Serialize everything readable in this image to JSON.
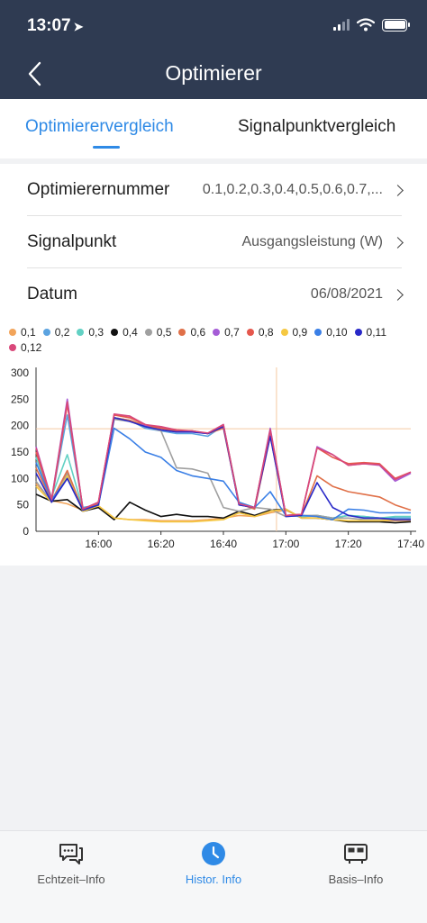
{
  "status_bar": {
    "time": "13:07"
  },
  "header": {
    "title": "Optimierer"
  },
  "tabs": [
    {
      "label": "Optimierervergleich",
      "active": true
    },
    {
      "label": "Signalpunktvergleich",
      "active": false
    }
  ],
  "settings": {
    "rows": [
      {
        "label": "Optimierernummer",
        "value": "0.1,0.2,0.3,0.4,0.5,0.6,0.7,..."
      },
      {
        "label": "Signalpunkt",
        "value": "Ausgangsleistung (W)"
      },
      {
        "label": "Datum",
        "value": "06/08/2021"
      }
    ]
  },
  "colors": {
    "accent": "#2f8ae6",
    "header_bg": "#2f3b52"
  },
  "chart_data": {
    "type": "line",
    "title": "",
    "xlabel": "",
    "ylabel": "",
    "x": [
      "15:40",
      "15:45",
      "15:50",
      "15:55",
      "16:00",
      "16:05",
      "16:10",
      "16:15",
      "16:20",
      "16:25",
      "16:30",
      "16:35",
      "16:40",
      "16:45",
      "16:50",
      "16:55",
      "17:00",
      "17:05",
      "17:10",
      "17:15",
      "17:20",
      "17:25",
      "17:30",
      "17:35",
      "17:40"
    ],
    "x_ticks": [
      "16:00",
      "16:20",
      "16:40",
      "17:00",
      "17:20",
      "17:40"
    ],
    "y_ticks": [
      0,
      50,
      100,
      150,
      200,
      250,
      300
    ],
    "ylim": [
      0,
      300
    ],
    "crosshair": {
      "x": "16:57",
      "y": 194
    },
    "grid": false,
    "legend_position": "top",
    "series": [
      {
        "name": "0,1",
        "color": "#f2a45a",
        "values": [
          90,
          58,
          52,
          40,
          48,
          25,
          22,
          22,
          20,
          20,
          20,
          22,
          25,
          30,
          28,
          35,
          40,
          26,
          25,
          22,
          20,
          20,
          20,
          20,
          20
        ]
      },
      {
        "name": "0,2",
        "color": "#5ba3e0",
        "values": [
          140,
          60,
          220,
          45,
          50,
          215,
          210,
          195,
          190,
          185,
          185,
          180,
          200,
          50,
          45,
          185,
          30,
          28,
          30,
          25,
          30,
          28,
          25,
          25,
          25
        ]
      },
      {
        "name": "0,3",
        "color": "#62d1c4",
        "values": [
          140,
          65,
          145,
          42,
          50,
          215,
          210,
          200,
          195,
          190,
          190,
          185,
          200,
          55,
          45,
          185,
          30,
          28,
          30,
          25,
          30,
          28,
          25,
          28,
          28
        ]
      },
      {
        "name": "0,4",
        "color": "#111111",
        "values": [
          70,
          57,
          60,
          38,
          45,
          22,
          55,
          40,
          28,
          32,
          28,
          28,
          25,
          38,
          30,
          40,
          42,
          25,
          25,
          22,
          18,
          18,
          18,
          16,
          18
        ]
      },
      {
        "name": "0,5",
        "color": "#a0a0a0",
        "values": [
          95,
          55,
          110,
          40,
          50,
          212,
          208,
          198,
          190,
          120,
          118,
          110,
          45,
          38,
          45,
          42,
          28,
          30,
          30,
          25,
          25,
          22,
          22,
          22,
          22
        ]
      },
      {
        "name": "0,6",
        "color": "#e07048",
        "values": [
          120,
          58,
          115,
          40,
          52,
          215,
          210,
          200,
          195,
          190,
          190,
          185,
          195,
          52,
          42,
          180,
          30,
          30,
          105,
          85,
          75,
          70,
          65,
          50,
          40
        ]
      },
      {
        "name": "0,7",
        "color": "#a55cd6",
        "values": [
          160,
          60,
          250,
          42,
          55,
          220,
          218,
          200,
          198,
          190,
          188,
          185,
          202,
          50,
          45,
          195,
          30,
          32,
          160,
          145,
          125,
          128,
          125,
          95,
          110
        ]
      },
      {
        "name": "0,8",
        "color": "#e5574d",
        "values": [
          150,
          58,
          240,
          42,
          55,
          220,
          215,
          202,
          195,
          190,
          190,
          185,
          200,
          52,
          45,
          192,
          30,
          32,
          158,
          140,
          128,
          130,
          128,
          100,
          112
        ]
      },
      {
        "name": "0,9",
        "color": "#f5c842",
        "values": [
          85,
          55,
          105,
          38,
          48,
          25,
          22,
          20,
          18,
          18,
          18,
          20,
          22,
          35,
          28,
          38,
          42,
          25,
          25,
          22,
          20,
          20,
          20,
          22,
          22
        ]
      },
      {
        "name": "0,10",
        "color": "#3a7fe6",
        "values": [
          130,
          60,
          100,
          40,
          50,
          195,
          175,
          150,
          140,
          115,
          105,
          100,
          95,
          55,
          45,
          75,
          30,
          30,
          28,
          22,
          42,
          40,
          35,
          35,
          35
        ]
      },
      {
        "name": "0,11",
        "color": "#2828c8",
        "values": [
          110,
          55,
          100,
          40,
          50,
          215,
          208,
          198,
          192,
          188,
          188,
          185,
          198,
          50,
          45,
          180,
          28,
          30,
          92,
          45,
          30,
          25,
          25,
          22,
          22
        ]
      },
      {
        "name": "0,12",
        "color": "#d9487a",
        "values": [
          158,
          60,
          245,
          42,
          55,
          222,
          218,
          202,
          198,
          192,
          190,
          186,
          202,
          52,
          45,
          192,
          30,
          32,
          158,
          145,
          125,
          128,
          126,
          98,
          112
        ]
      }
    ]
  },
  "tabbar": {
    "items": [
      {
        "label": "Echtzeit–Info",
        "icon": "chat-icon",
        "active": false
      },
      {
        "label": "Histor. Info",
        "icon": "clock-icon",
        "active": true
      },
      {
        "label": "Basis–Info",
        "icon": "device-icon",
        "active": false
      }
    ]
  }
}
